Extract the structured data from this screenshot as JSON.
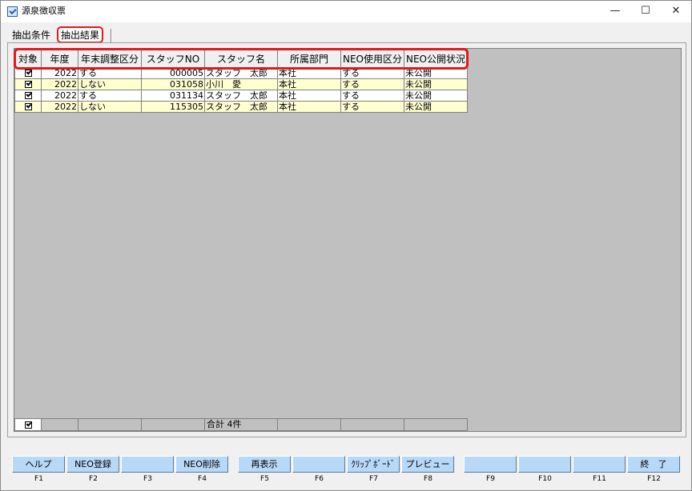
{
  "window": {
    "title": "源泉徴収票",
    "controls": {
      "minimize": "—",
      "maximize": "☐",
      "close": "✕"
    },
    "icon": "app-icon"
  },
  "tabs": [
    {
      "label": "抽出条件",
      "selected": false
    },
    {
      "label": "抽出結果",
      "selected": true
    }
  ],
  "grid": {
    "columns": [
      "対象",
      "年度",
      "年末調整区分",
      "スタッフNO",
      "スタッフ名",
      "所属部門",
      "NEO使用区分",
      "NEO公開状況"
    ],
    "rows": [
      {
        "checked": true,
        "year": "2022",
        "adjust": "する",
        "staff_no": "000005",
        "staff_name": "スタッフ　太郎",
        "dept": "本社",
        "neo_use": "する",
        "neo_status": "未公開"
      },
      {
        "checked": true,
        "year": "2022",
        "adjust": "しない",
        "staff_no": "031058",
        "staff_name": "小川　愛",
        "dept": "本社",
        "neo_use": "する",
        "neo_status": "未公開"
      },
      {
        "checked": true,
        "year": "2022",
        "adjust": "する",
        "staff_no": "031134",
        "staff_name": "スタッフ　太郎",
        "dept": "本社",
        "neo_use": "する",
        "neo_status": "未公開"
      },
      {
        "checked": true,
        "year": "2022",
        "adjust": "しない",
        "staff_no": "115305",
        "staff_name": "スタッフ　太郎",
        "dept": "本社",
        "neo_use": "する",
        "neo_status": "未公開"
      }
    ],
    "footer": {
      "checked": true,
      "total_label": "合計 4件"
    }
  },
  "fkeys": [
    {
      "key": "F1",
      "label": "ヘルプ"
    },
    {
      "key": "F2",
      "label": "NEO登録"
    },
    {
      "key": "F3",
      "label": ""
    },
    {
      "key": "F4",
      "label": "NEO削除"
    },
    {
      "key": "F5",
      "label": "再表示"
    },
    {
      "key": "F6",
      "label": ""
    },
    {
      "key": "F7",
      "label": "ｸﾘｯﾌﾟﾎﾞｰﾄﾞ"
    },
    {
      "key": "F8",
      "label": "プレビュー"
    },
    {
      "key": "F9",
      "label": ""
    },
    {
      "key": "F10",
      "label": ""
    },
    {
      "key": "F11",
      "label": ""
    },
    {
      "key": "F12",
      "label": "終　了"
    }
  ],
  "colors": {
    "highlight": "#e0191d",
    "row_alt": "#ffffd0",
    "fkey_bg": "#b8d8f8",
    "grid_bg": "#c0c0c0"
  }
}
